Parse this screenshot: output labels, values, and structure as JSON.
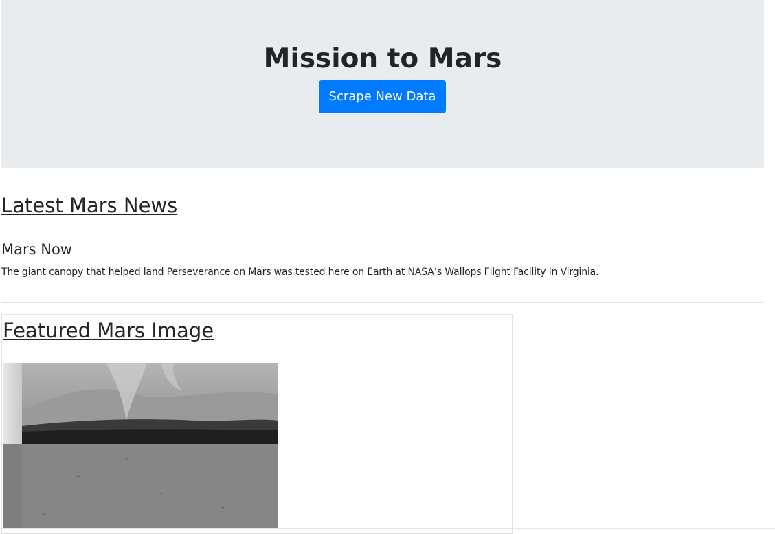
{
  "header": {
    "title": "Mission to Mars",
    "scrape_button_label": "Scrape New Data"
  },
  "news": {
    "heading": "Latest Mars News",
    "title": "Mars Now",
    "paragraph": "The giant canopy that helped land Perseverance on Mars was tested here on Earth at NASA’s Wallops Flight Facility in Virginia."
  },
  "featured": {
    "heading": "Featured Mars Image"
  },
  "colors": {
    "jumbotron_bg": "#e9ecef",
    "button_primary": "#007bff",
    "text": "#212529"
  }
}
